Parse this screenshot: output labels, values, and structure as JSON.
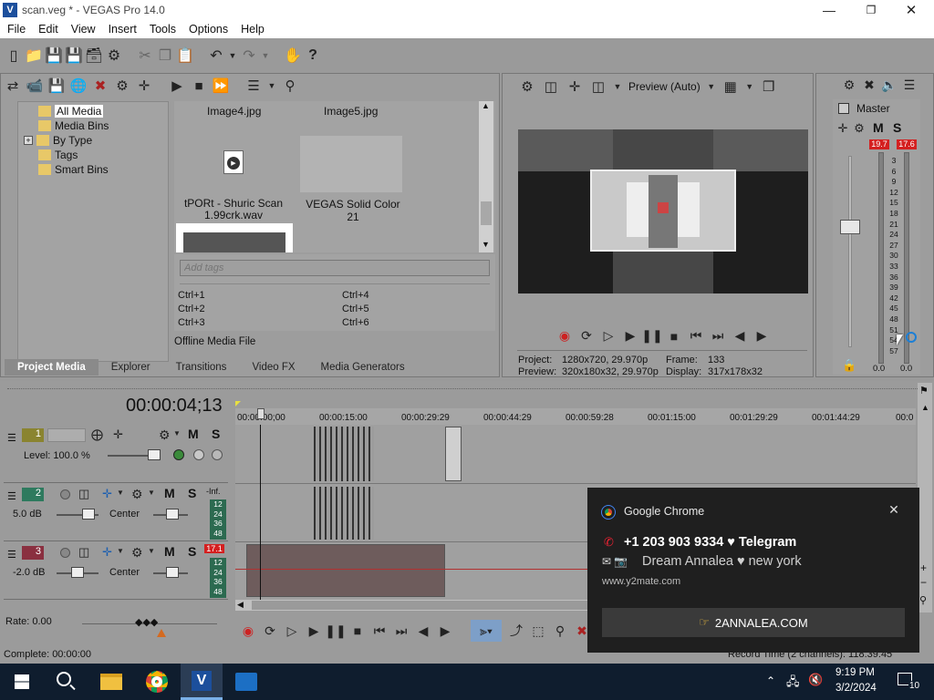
{
  "window": {
    "title": "scan.veg * - VEGAS Pro 14.0"
  },
  "menu": [
    "File",
    "Edit",
    "View",
    "Insert",
    "Tools",
    "Options",
    "Help"
  ],
  "project_media": {
    "tree": [
      "All Media",
      "Media Bins",
      "By Type",
      "Tags",
      "Smart Bins"
    ],
    "files": [
      {
        "name": "Image4.jpg"
      },
      {
        "name": "Image5.jpg"
      },
      {
        "name": "tPORt - Shuric Scan 1.99crk.wav"
      },
      {
        "name": "VEGAS Solid Color 21"
      }
    ],
    "tags_placeholder": "Add tags",
    "shortcuts": [
      "Ctrl+1",
      "Ctrl+4",
      "Ctrl+2",
      "Ctrl+5",
      "Ctrl+3",
      "Ctrl+6"
    ],
    "status": "Offline Media File"
  },
  "tabs": [
    "Project Media",
    "Explorer",
    "Transitions",
    "Video FX",
    "Media Generators"
  ],
  "preview": {
    "mode": "Preview (Auto)",
    "project_label": "Project:",
    "project_value": "1280x720, 29.970p",
    "preview_label": "Preview:",
    "preview_value": "320x180x32, 29.970p",
    "frame_label": "Frame:",
    "frame_value": "133",
    "display_label": "Display:",
    "display_value": "317x178x32"
  },
  "master": {
    "title": "Master",
    "m": "M",
    "s": "S",
    "peak_left": "19.7",
    "peak_right": "17.6",
    "scale": [
      "3",
      "6",
      "9",
      "12",
      "15",
      "18",
      "21",
      "24",
      "27",
      "30",
      "33",
      "36",
      "39",
      "42",
      "45",
      "48",
      "51",
      "54",
      "57"
    ],
    "level_left": "0.0",
    "level_right": "0.0"
  },
  "timeline": {
    "timecode": "00:00:04;13",
    "ruler": [
      "00:00:00;00",
      "00:00:15:00",
      "00:00:29:29",
      "00:00:44:29",
      "00:00:59:28",
      "00:01:15:00",
      "00:01:29:29",
      "00:01:44:29",
      "00:0"
    ],
    "tracks": [
      {
        "num": "1",
        "level": "Level: 100.0 %",
        "m": "M",
        "s": "S"
      },
      {
        "num": "2",
        "level": "5.0 dB",
        "pan": "Center",
        "m": "M",
        "s": "S",
        "meter_top": "-Inf.",
        "meter": [
          "12",
          "24",
          "36",
          "48"
        ]
      },
      {
        "num": "3",
        "level": "-2.0 dB",
        "pan": "Center",
        "m": "M",
        "s": "S",
        "meter_top": "17.1",
        "meter": [
          "12",
          "24",
          "36",
          "48"
        ]
      }
    ],
    "rate": "Rate: 0.00"
  },
  "statusbar": {
    "left": "Complete: 00:00:00",
    "right": "Record Time (2 channels): 118:39:45"
  },
  "notification": {
    "app": "Google Chrome",
    "line1": "+1 203 903 9334 ♥ Telegram",
    "line2": "Dream Annalea ♥ new york",
    "site": "www.y2mate.com",
    "button": "2ANNALEA.COM"
  },
  "taskbar": {
    "time": "9:19 PM",
    "date": "3/2/2024",
    "notif_count": "10"
  },
  "colors": {
    "accent": "#1c7fd6",
    "peak": "#d42020",
    "panel": "#9d9d9d"
  }
}
